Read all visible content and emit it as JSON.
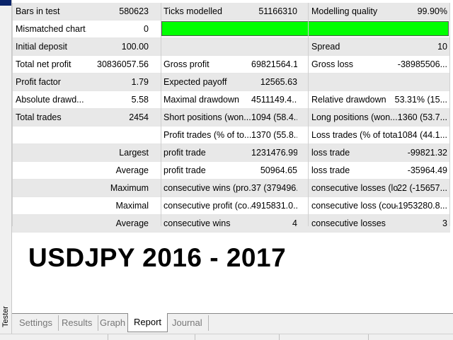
{
  "window": {
    "side_label": "Tester"
  },
  "report": {
    "row1": {
      "c1": "Bars in test",
      "v1": "580623",
      "c2": "Ticks modelled",
      "v2": "51166310",
      "c3": "Modelling quality",
      "v3": "99.90%"
    },
    "row2": {
      "c1": "Mismatched chart...",
      "v1": "0"
    },
    "row3": {
      "c1": "Initial deposit",
      "v1": "100.00",
      "c3": "Spread",
      "v3": "10"
    },
    "row4": {
      "c1": "Total net profit",
      "v1": "30836057.56",
      "c2": "Gross profit",
      "v2": "69821564.17",
      "c3": "Gross loss",
      "v3": "-38985506..."
    },
    "row5": {
      "c1": "Profit factor",
      "v1": "1.79",
      "c2": "Expected payoff",
      "v2": "12565.63"
    },
    "row6": {
      "c1": "Absolute drawd...",
      "v1": "5.58",
      "c2": "Maximal drawdown",
      "v2": "4511149.4...",
      "c3": "Relative drawdown",
      "v3": "53.31% (15..."
    },
    "row7": {
      "c1": "Total trades",
      "v1": "2454",
      "c2": "Short positions (won...",
      "v2": "1094 (58.4...",
      "c3": "Long positions (won...",
      "v3": "1360 (53.7..."
    },
    "row8": {
      "c2": "Profit trades (% of to...",
      "v2": "1370 (55.8...",
      "c3": "Loss trades (% of total)",
      "v3": "1084 (44.1..."
    },
    "row9": {
      "v1": "Largest",
      "c2": "profit trade",
      "v2": "1231476.99",
      "c3": "loss trade",
      "v3": "-99821.32"
    },
    "row10": {
      "v1": "Average",
      "c2": "profit trade",
      "v2": "50964.65",
      "c3": "loss trade",
      "v3": "-35964.49"
    },
    "row11": {
      "v1": "Maximum",
      "c2": "consecutive wins (pro...",
      "v2": "37 (379496...",
      "c3": "consecutive losses (lo...",
      "v3": "22 (-15657..."
    },
    "row12": {
      "v1": "Maximal",
      "c2": "consecutive profit (co...",
      "v2": "4915831.0...",
      "c3": "consecutive loss (cou...",
      "v3": "-1953280.8..."
    },
    "row13": {
      "v1": "Average",
      "c2": "consecutive wins",
      "v2": "4",
      "c3": "consecutive losses",
      "v3": "3"
    }
  },
  "headline": "USDJPY 2016 - 2017",
  "tabs": [
    "Settings",
    "Results",
    "Graph",
    "Report",
    "Journal"
  ],
  "active_tab": "Report",
  "colors": {
    "quality_bar": "#00ff00",
    "row_alt": "#e8e8e8"
  }
}
